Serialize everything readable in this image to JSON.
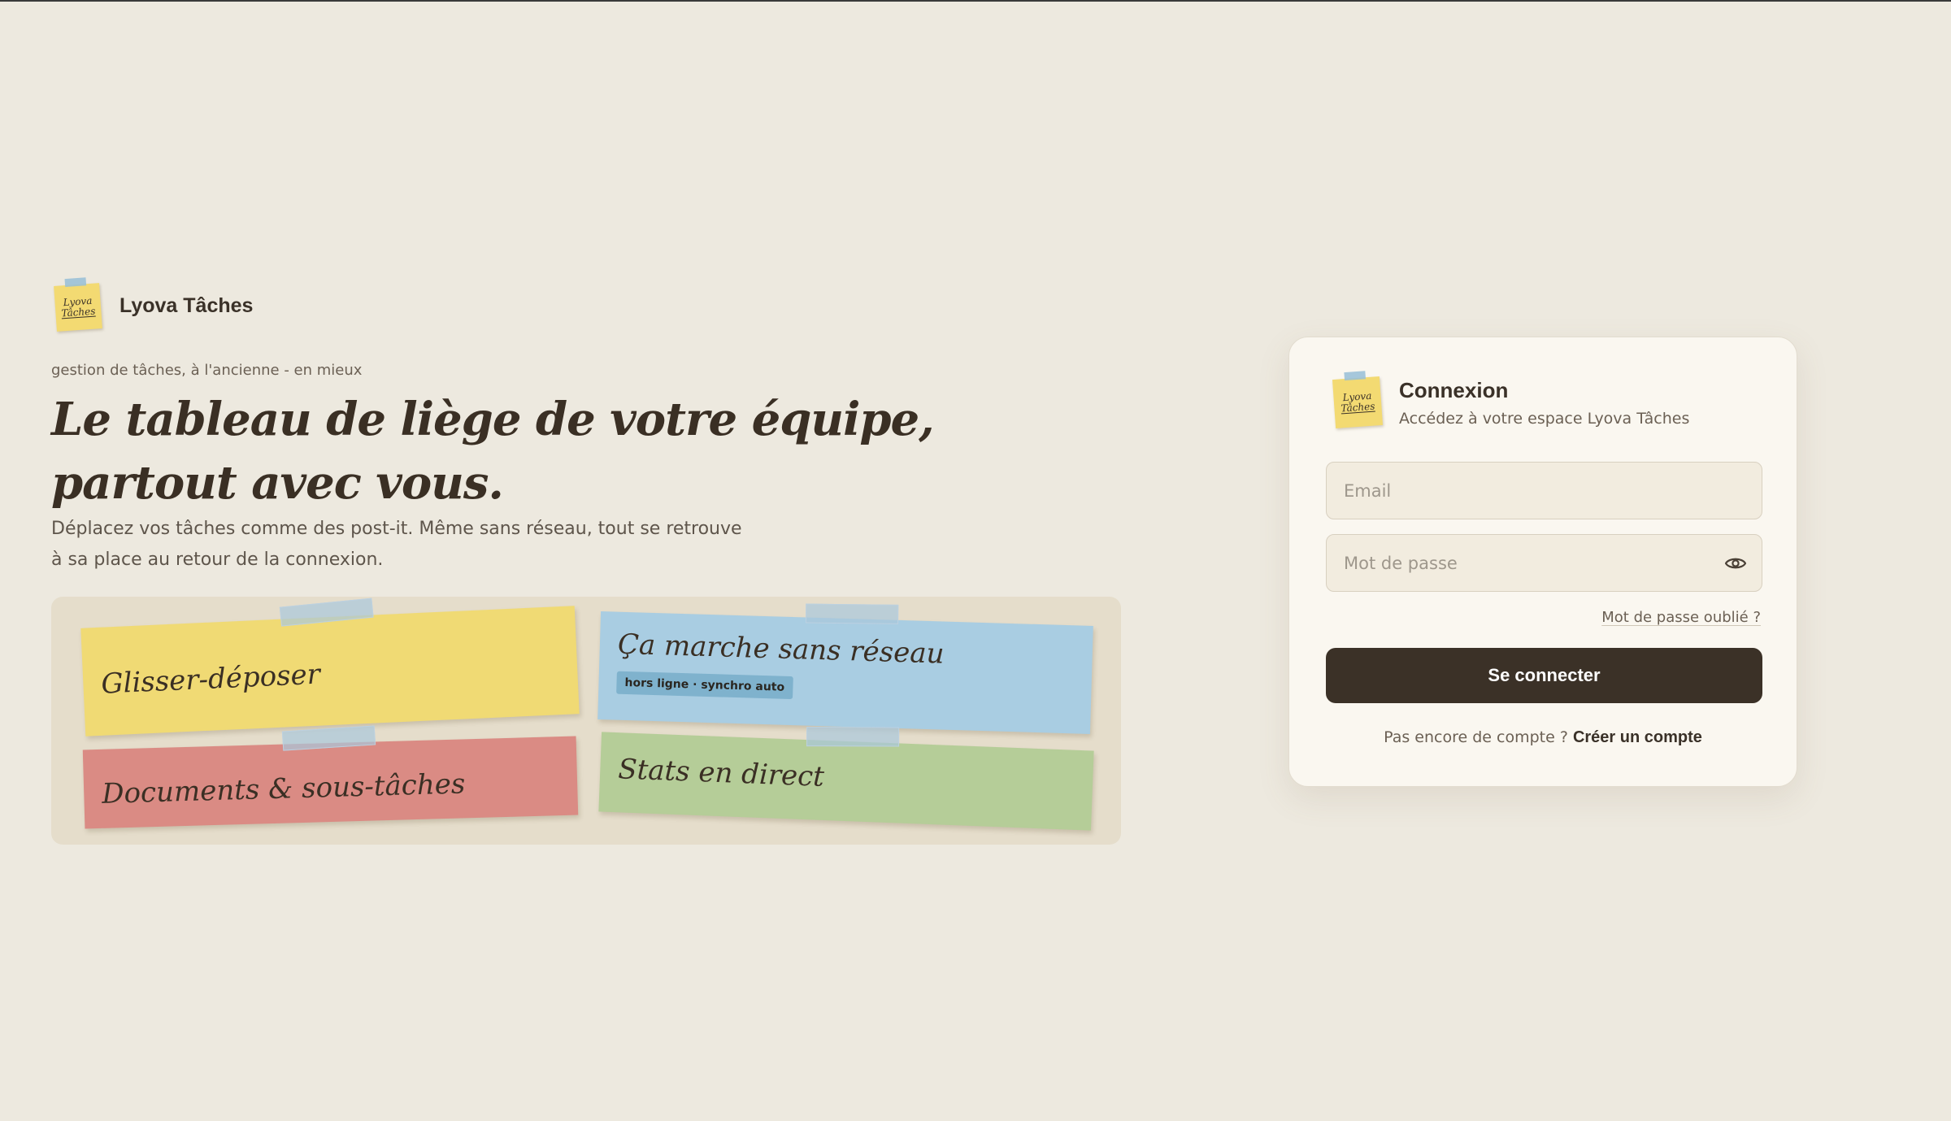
{
  "brand": {
    "name": "Lyova Tâches",
    "logo_line1": "Lyova",
    "logo_line2": "Tâches"
  },
  "hero": {
    "tagline": "gestion de tâches, à l'ancienne - en mieux",
    "headline": "Le tableau de liège de votre équipe, partout avec vous.",
    "lede": "Déplacez vos tâches comme des post-it. Même sans réseau, tout se retrouve à sa place au retour de la connexion."
  },
  "features": [
    {
      "label": "Glisser-déposer",
      "color": "#f0da74"
    },
    {
      "label": "Ça marche sans réseau",
      "badge": "hors ligne · synchro auto",
      "color": "#a9cde2"
    },
    {
      "label": "Documents & sous-tâches",
      "color": "#da8b84"
    },
    {
      "label": "Stats en direct",
      "color": "#b5cd98"
    }
  ],
  "login": {
    "title": "Connexion",
    "subtitle": "Accédez à votre espace Lyova Tâches",
    "email_placeholder": "Email",
    "password_placeholder": "Mot de passe",
    "forgot_label": "Mot de passe oublié ?",
    "submit_label": "Se connecter",
    "signup_prompt": "Pas encore de compte ?",
    "signup_link": "Créer un compte",
    "password_toggle_icon": "eye-icon"
  },
  "colors": {
    "background": "#ede9df",
    "card": "#faf7f0",
    "primary_button": "#3b3127",
    "text": "#3a3128"
  }
}
